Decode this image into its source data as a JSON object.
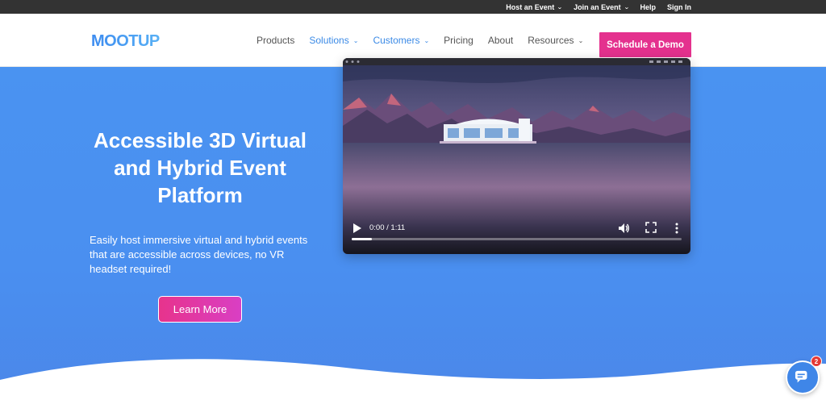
{
  "topbar": {
    "items": [
      {
        "label": "Host an Event",
        "has_dropdown": true
      },
      {
        "label": "Join an Event",
        "has_dropdown": true
      },
      {
        "label": "Help",
        "has_dropdown": false
      },
      {
        "label": "Sign In",
        "has_dropdown": false
      }
    ]
  },
  "header": {
    "logo_text": "MOOTUP",
    "nav": [
      {
        "label": "Products",
        "has_dropdown": false,
        "active": false
      },
      {
        "label": "Solutions",
        "has_dropdown": true,
        "active": true
      },
      {
        "label": "Customers",
        "has_dropdown": true,
        "active": true
      },
      {
        "label": "Pricing",
        "has_dropdown": false,
        "active": false
      },
      {
        "label": "About",
        "has_dropdown": false,
        "active": false
      },
      {
        "label": "Resources",
        "has_dropdown": true,
        "active": false
      }
    ],
    "cta_label": "Schedule a Demo"
  },
  "hero": {
    "headline": "Accessible 3D Virtual and Hybrid Event Platform",
    "subtext": "Easily host immersive virtual and hybrid events that are accessible across devices, no VR headset required!",
    "cta_label": "Learn More"
  },
  "video": {
    "time": "0:00 / 1:11",
    "progress": 0.06,
    "icons": [
      "play-icon",
      "volume-icon",
      "fullscreen-icon",
      "more-options-icon"
    ]
  },
  "chat": {
    "badge_count": "2",
    "icon": "chat-icon"
  },
  "colors": {
    "topbar_bg": "#333333",
    "accent_blue": "#3b8ae6",
    "cta_pink": "#e4318e",
    "hero_blue": "#4a90f0"
  }
}
